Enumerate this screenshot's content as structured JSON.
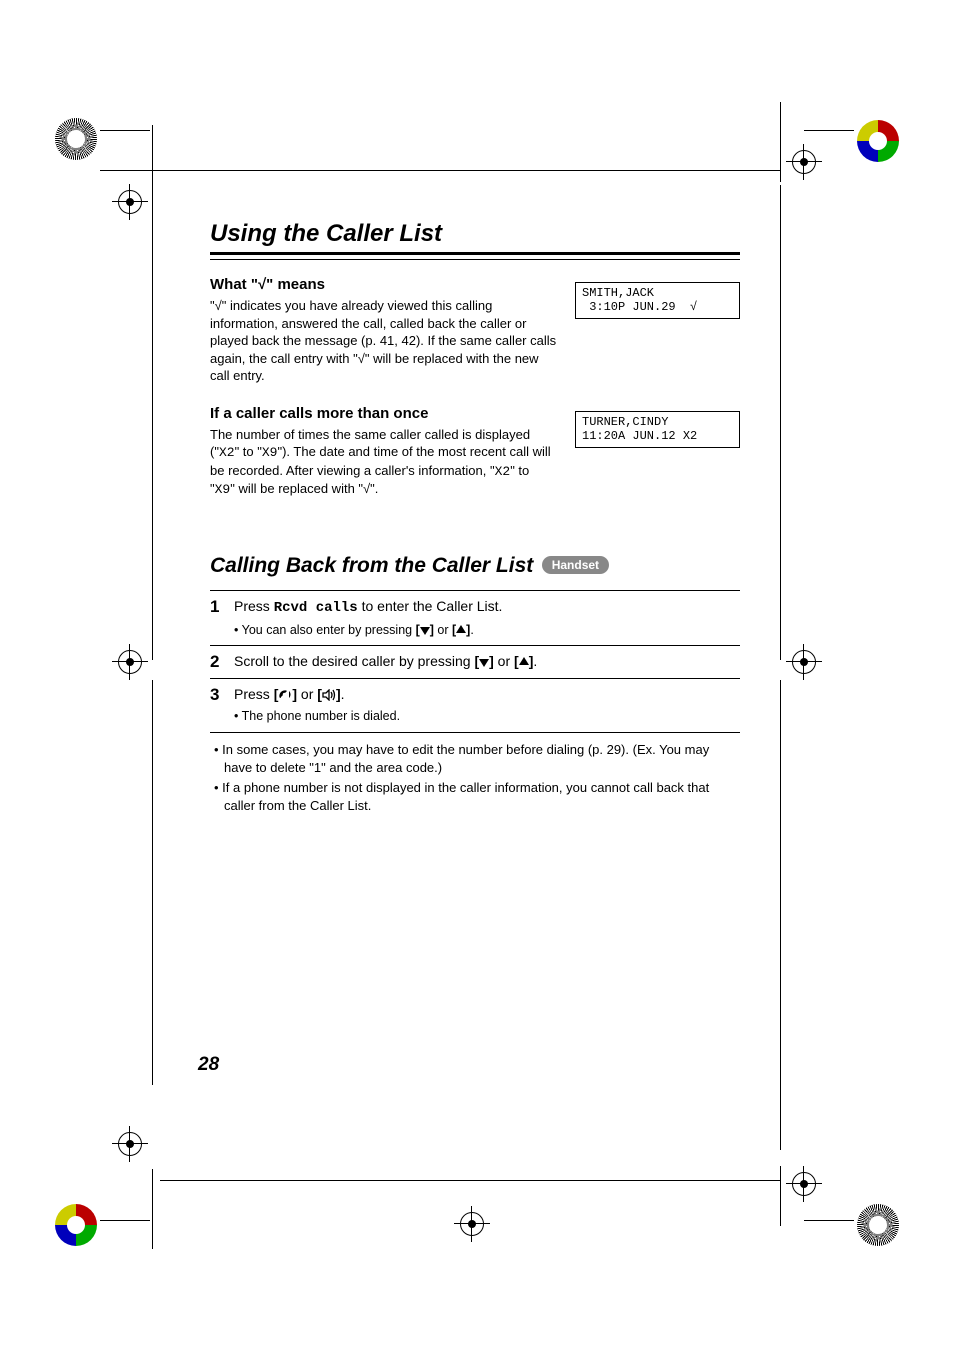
{
  "page_title": "Using the Caller List",
  "page_number": "28",
  "section_checkmark": {
    "heading_prefix": "What \"",
    "heading_symbol": "√",
    "heading_suffix": "\" means",
    "body_pre": "\"",
    "body_sym1": "√",
    "body_mid1": "\" indicates you have already viewed this calling information, answered the call, called back the caller or played back the message (p. 41, 42). If the same caller calls again, the call entry with \"",
    "body_sym2": "√",
    "body_mid2": "\" will be replaced with the new call entry.",
    "lcd_line1": "SMITH,JACK",
    "lcd_line2": " 3:10P JUN.29  √"
  },
  "section_multi": {
    "heading": "If a caller calls more than once",
    "body_a": "The number of times the same caller called is displayed (\"",
    "x2a": "X2",
    "body_b": "\" to \"",
    "x9a": "X9",
    "body_c": "\"). The date and time of the most recent call will be recorded. After viewing a caller's information, \"",
    "x2b": "X2",
    "body_d": "\" to \"",
    "x9b": "X9",
    "body_e": "\" will be replaced with \"",
    "sym": "√",
    "body_f": "\".",
    "lcd_line1": "TURNER,CINDY",
    "lcd_line2": "11:20A JUN.12 X2"
  },
  "section_calling_back": {
    "title": "Calling Back from the Caller List",
    "pill": "Handset",
    "step1_a": "Press ",
    "step1_key": "Rcvd calls",
    "step1_b": " to enter the Caller List.",
    "step1_sub_a": "• You can also enter by pressing ",
    "step1_sub_b": " or ",
    "step1_sub_c": ".",
    "step2_a": "Scroll to the desired caller by pressing ",
    "step2_b": " or ",
    "step2_c": ".",
    "step3_a": "Press ",
    "step3_b": " or ",
    "step3_c": ".",
    "step3_sub": "• The phone number is dialed.",
    "note1": "• In some cases, you may have to edit the number before dialing (p. 29). (Ex. You may have to delete \"1\" and the area code.)",
    "note2": "• If a phone number is not displayed in the caller information, you cannot call back that caller from the Caller List."
  },
  "key_labels": {
    "down_open": "[",
    "down_close": "]",
    "up_open": "[",
    "up_close": "]",
    "phone_open": "[",
    "phone_close": "]",
    "speaker_open": "[",
    "speaker_close": "]"
  }
}
